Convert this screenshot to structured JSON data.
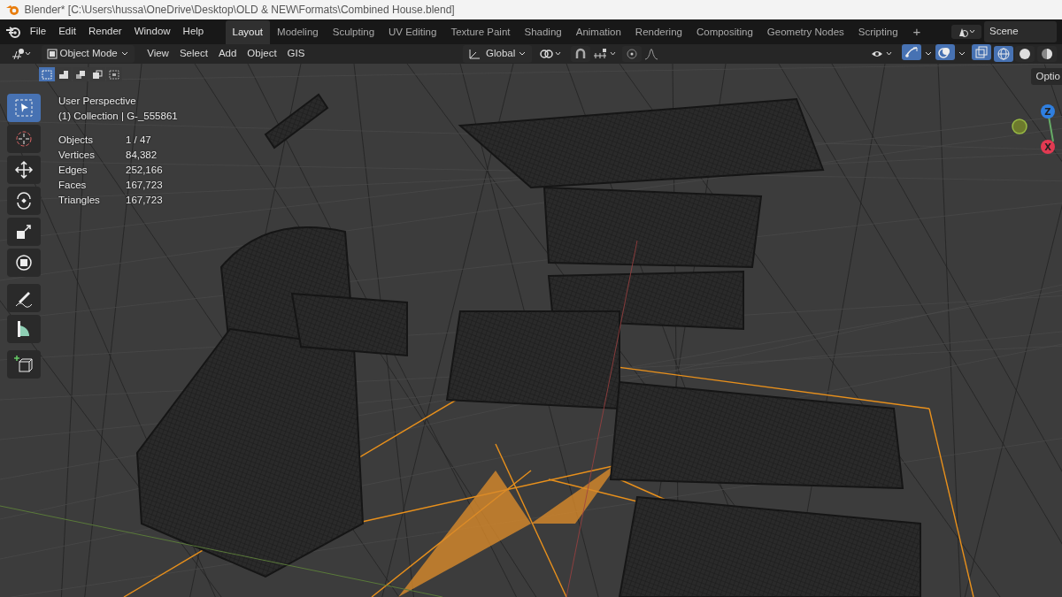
{
  "window": {
    "title": "Blender* [C:\\Users\\hussa\\OneDrive\\Desktop\\OLD & NEW\\Formats\\Combined House.blend]"
  },
  "menu": [
    "File",
    "Edit",
    "Render",
    "Window",
    "Help"
  ],
  "workspaces": [
    {
      "label": "Layout",
      "selected": true
    },
    {
      "label": "Modeling",
      "selected": false
    },
    {
      "label": "Sculpting",
      "selected": false
    },
    {
      "label": "UV Editing",
      "selected": false
    },
    {
      "label": "Texture Paint",
      "selected": false
    },
    {
      "label": "Shading",
      "selected": false
    },
    {
      "label": "Animation",
      "selected": false
    },
    {
      "label": "Rendering",
      "selected": false
    },
    {
      "label": "Compositing",
      "selected": false
    },
    {
      "label": "Geometry Nodes",
      "selected": false
    },
    {
      "label": "Scripting",
      "selected": false
    }
  ],
  "add_workspace": "+",
  "scene": "Scene",
  "header": {
    "mode": "Object Mode",
    "menus": [
      "View",
      "Select",
      "Add",
      "Object",
      "GIS"
    ],
    "orientation": "Global",
    "snap_on": false,
    "proportional_on": false,
    "gizmos_on": true,
    "overlays_on": true,
    "xray_on": true,
    "shading_modes": [
      {
        "kind": "wireframe",
        "selected": true
      },
      {
        "kind": "solid",
        "selected": false
      },
      {
        "kind": "material",
        "selected": false
      }
    ]
  },
  "select_modes": [
    {
      "selected": true
    },
    {
      "selected": false
    },
    {
      "selected": false
    },
    {
      "selected": false
    },
    {
      "selected": false
    }
  ],
  "tools": [
    {
      "kind": "select",
      "selected": true
    },
    {
      "kind": "cursor",
      "selected": false
    },
    {
      "kind": "move",
      "selected": false
    },
    {
      "kind": "rotate",
      "selected": false
    },
    {
      "kind": "scale",
      "selected": false
    },
    {
      "kind": "transform",
      "selected": false
    },
    {
      "kind": "annotate",
      "selected": false
    },
    {
      "kind": "measure",
      "selected": false
    },
    {
      "kind": "add-cube",
      "selected": false
    }
  ],
  "overlay": {
    "lines": [
      "User Perspective",
      "(1) Collection | G-_555861"
    ],
    "stats": [
      {
        "label": "Objects",
        "value": "1 / 47"
      },
      {
        "label": "Vertices",
        "value": "84,382"
      },
      {
        "label": "Edges",
        "value": "252,166"
      },
      {
        "label": "Faces",
        "value": "167,723"
      },
      {
        "label": "Triangles",
        "value": "167,723"
      }
    ]
  },
  "options": "Optio",
  "gizmo": [
    {
      "label": "Z",
      "color": "#2f7fe0"
    },
    {
      "label": "X",
      "color": "#e23a52"
    }
  ]
}
